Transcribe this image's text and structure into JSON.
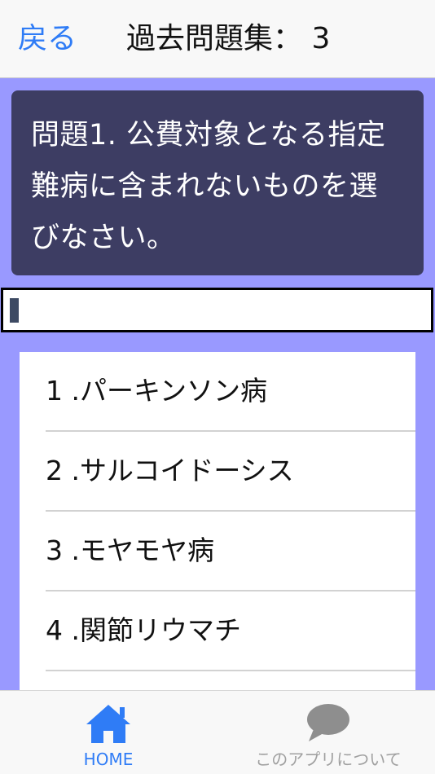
{
  "navbar": {
    "back_label": "戻る",
    "title": "過去問題集： 3"
  },
  "question": {
    "text": "問題1. 公費対象となる指定難病に含まれないものを選びなさい。"
  },
  "answer_input": {
    "value": ""
  },
  "choices": [
    {
      "label": "1 .パーキンソン病"
    },
    {
      "label": "2 .サルコイドーシス"
    },
    {
      "label": "3 .モヤモヤ病"
    },
    {
      "label": "4 .関節リウマチ"
    }
  ],
  "tabbar": {
    "home": {
      "label": "HOME",
      "icon": "home-icon",
      "color": "#2f7cf6"
    },
    "about": {
      "label": "このアプリについて",
      "icon": "speech-bubble-icon",
      "color": "#a0a0a0"
    }
  },
  "colors": {
    "background": "#9999ff",
    "question_card": "#3d3d63",
    "accent": "#2f7cf6"
  }
}
